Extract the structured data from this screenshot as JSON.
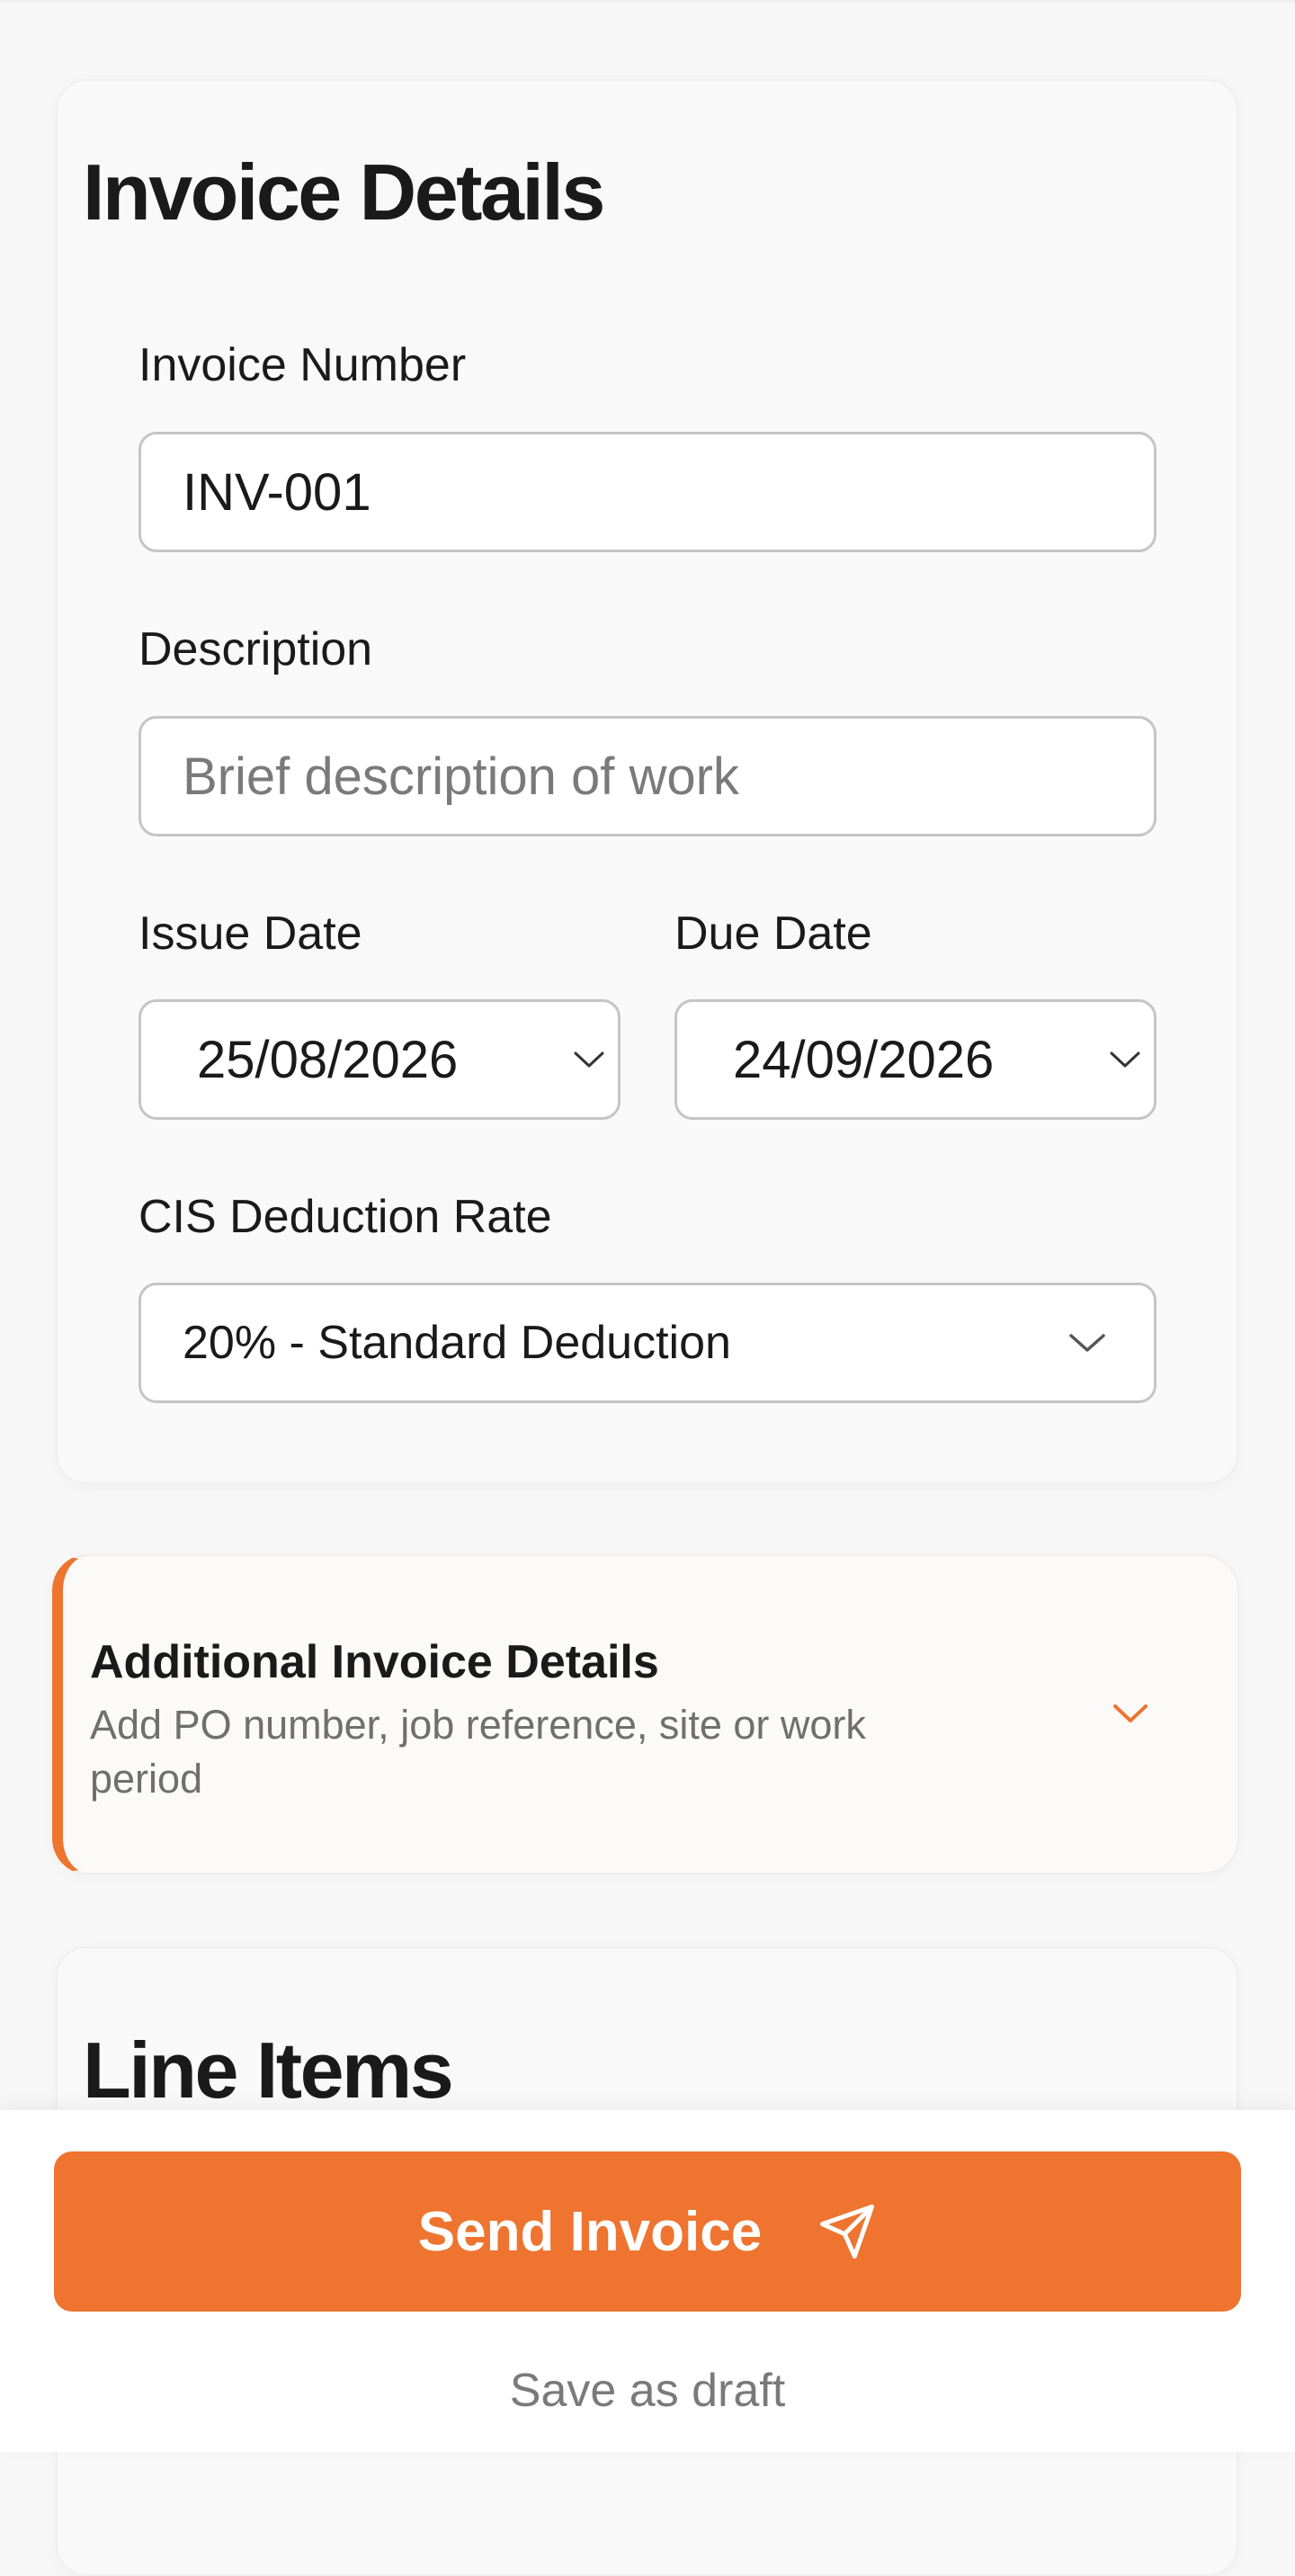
{
  "invoice_details": {
    "title": "Invoice Details",
    "invoice_number": {
      "label": "Invoice Number",
      "value": "INV-001"
    },
    "description": {
      "label": "Description",
      "placeholder": "Brief description of work",
      "value": ""
    },
    "issue_date": {
      "label": "Issue Date",
      "value": "25/08/2026",
      "icon": "chevron-down-icon"
    },
    "due_date": {
      "label": "Due Date",
      "value": "24/09/2026",
      "icon": "chevron-down-icon"
    },
    "cis_rate": {
      "label": "CIS Deduction Rate",
      "selected": "20% - Standard Deduction",
      "icon": "chevron-down-icon"
    }
  },
  "additional_details": {
    "title": "Additional Invoice Details",
    "subtitle": "Add PO number, job reference, site or work period",
    "icon": "chevron-down-icon"
  },
  "line_items": {
    "title": "Line Items"
  },
  "actions": {
    "send_label": "Send Invoice",
    "send_icon": "send-icon",
    "draft_label": "Save as draft"
  },
  "colors": {
    "accent": "#EE7430",
    "background": "#F7F7F7",
    "card": "#F9F9F9",
    "border": "#C5C5C5",
    "muted_text": "#7A7A7A"
  }
}
